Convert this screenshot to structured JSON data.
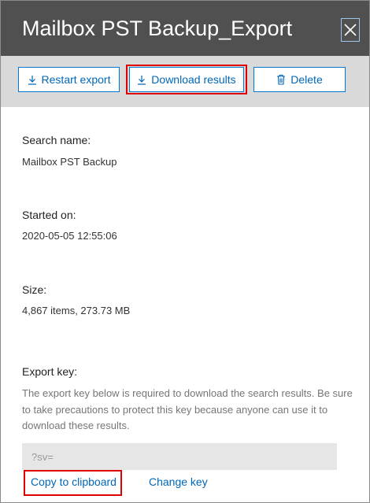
{
  "panel": {
    "title": "Mailbox PST Backup_Export"
  },
  "toolbar": {
    "restart_label": "Restart export",
    "download_label": "Download results",
    "delete_label": "Delete"
  },
  "details": {
    "search_name_label": "Search name:",
    "search_name_value": "Mailbox PST Backup",
    "started_on_label": "Started on:",
    "started_on_value": "2020-05-05 12:55:06",
    "size_label": "Size:",
    "size_value": "4,867 items, 273.73 MB"
  },
  "export_key": {
    "label": "Export key:",
    "description": "The export key below is required to download the search results. Be sure to take precautions to protect this key because anyone can use it to download these results.",
    "value": "?sv=",
    "copy_label": "Copy to clipboard",
    "change_label": "Change key"
  },
  "icons": {
    "close": "close-icon",
    "restart": "download-icon",
    "download": "download-icon",
    "delete": "trash-icon"
  },
  "colors": {
    "header_bg": "#505050",
    "toolbar_bg": "#d9d9d9",
    "accent": "#0078d4",
    "highlight": "#e00000"
  }
}
